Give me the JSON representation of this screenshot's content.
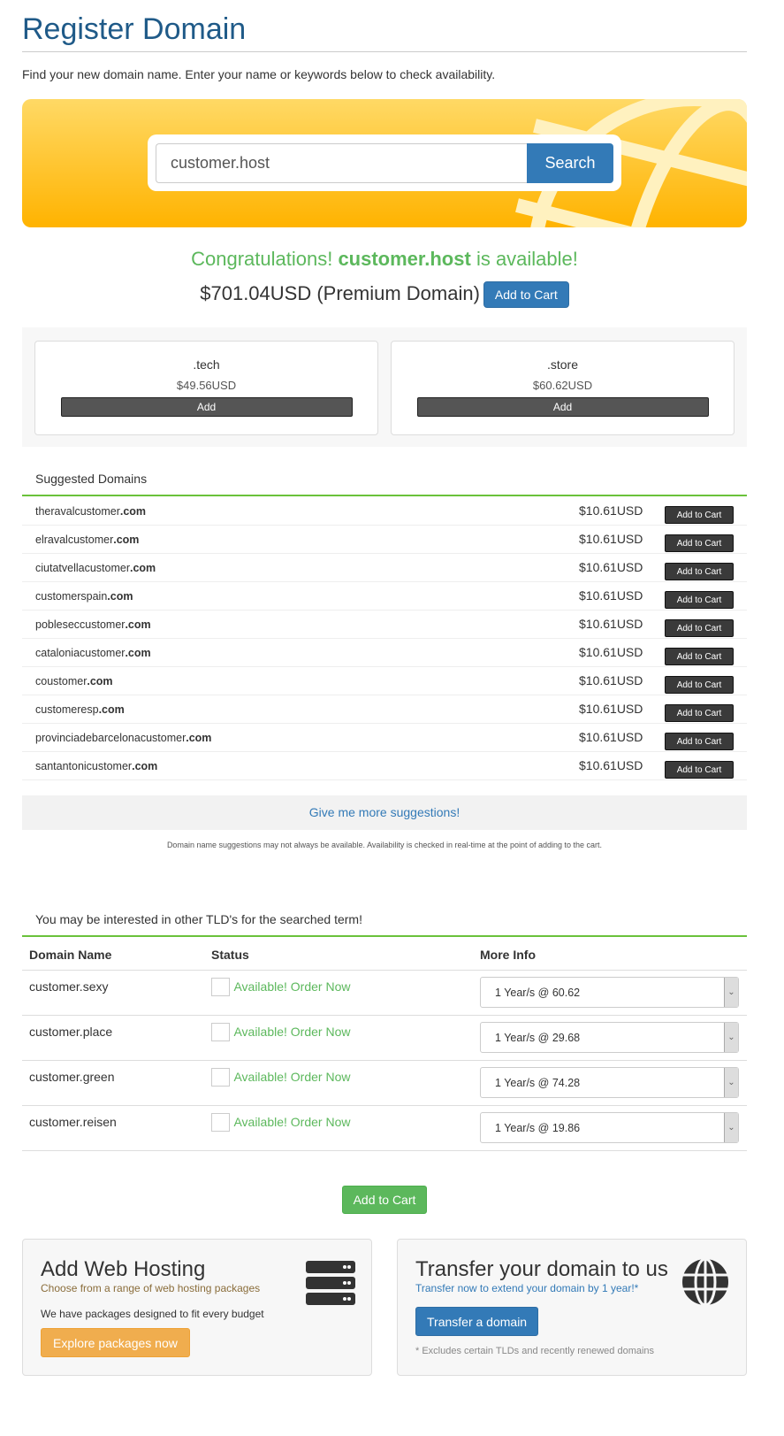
{
  "page": {
    "title": "Register Domain",
    "intro": "Find your new domain name. Enter your name or keywords below to check availability."
  },
  "search": {
    "value": "customer.host",
    "button": "Search"
  },
  "result": {
    "congrats_prefix": "Congratulations!",
    "domain": "customer.host",
    "congrats_suffix": "is available!",
    "price": "$701.04USD (Premium Domain)",
    "add_label": "Add to Cart"
  },
  "spotlight": [
    {
      "tld": ".tech",
      "price": "$49.56USD",
      "button": "Add"
    },
    {
      "tld": ".store",
      "price": "$60.62USD",
      "button": "Add"
    }
  ],
  "suggested": {
    "heading": "Suggested Domains",
    "button": "Add to Cart",
    "items": [
      {
        "name": "theravalcustomer",
        "tld": ".com",
        "price": "$10.61USD"
      },
      {
        "name": "elravalcustomer",
        "tld": ".com",
        "price": "$10.61USD"
      },
      {
        "name": "ciutatvellacustomer",
        "tld": ".com",
        "price": "$10.61USD"
      },
      {
        "name": "customerspain",
        "tld": ".com",
        "price": "$10.61USD"
      },
      {
        "name": "poblesеccustomer",
        "tld": ".com",
        "price": "$10.61USD"
      },
      {
        "name": "cataloniacustomer",
        "tld": ".com",
        "price": "$10.61USD"
      },
      {
        "name": "coustomer",
        "tld": ".com",
        "price": "$10.61USD"
      },
      {
        "name": "customeresp",
        "tld": ".com",
        "price": "$10.61USD"
      },
      {
        "name": "provinciadebarcelonacustomer",
        "tld": ".com",
        "price": "$10.61USD"
      },
      {
        "name": "santantonicustomer",
        "tld": ".com",
        "price": "$10.61USD"
      }
    ],
    "more": "Give me more suggestions!",
    "disclaimer": "Domain name suggestions may not always be available. Availability is checked in real-time at the point of adding to the cart."
  },
  "other_tlds": {
    "heading": "You may be interested in other TLD's for the searched term!",
    "columns": [
      "Domain Name",
      "Status",
      "More Info"
    ],
    "rows": [
      {
        "domain": "customer.sexy",
        "status": "Available! Order Now",
        "option": "1 Year/s @ 60.62"
      },
      {
        "domain": "customer.place",
        "status": "Available! Order Now",
        "option": "1 Year/s @ 29.68"
      },
      {
        "domain": "customer.green",
        "status": "Available! Order Now",
        "option": "1 Year/s @ 74.28"
      },
      {
        "domain": "customer.reisen",
        "status": "Available! Order Now",
        "option": "1 Year/s @ 19.86"
      }
    ],
    "add_label": "Add to Cart"
  },
  "hosting": {
    "title": "Add Web Hosting",
    "subtitle": "Choose from a range of web hosting packages",
    "text": "We have packages designed to fit every budget",
    "button": "Explore packages now"
  },
  "transfer": {
    "title": "Transfer your domain to us",
    "subtitle": "Transfer now to extend your domain by 1 year!*",
    "button": "Transfer a domain",
    "note": "* Excludes certain TLDs and recently renewed domains"
  }
}
